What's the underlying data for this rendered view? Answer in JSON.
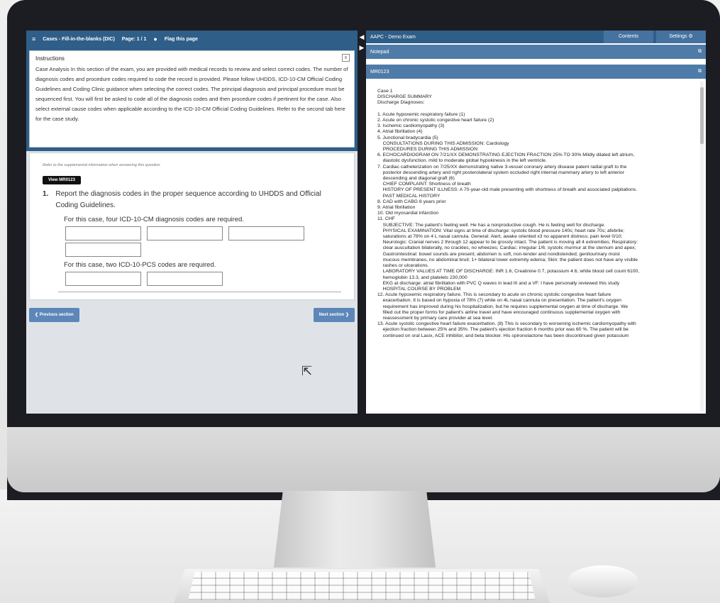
{
  "left": {
    "topbar": {
      "menu_icon": "hamburger-icon",
      "section": "Cases - Fill-in-the-blanks (DIC)",
      "page": "Page: 1 / 1",
      "flag_label": "Flag this page"
    },
    "instructions": {
      "title": "Instructions",
      "close": "x",
      "text": "Case Analysis In this section of the exam, you are provided with medical records to review and select correct codes. The number of diagnosis codes and procedure codes required to code the record is provided. Please follow UHDDS, ICD-10-CM Official Coding Guidelines and Coding Clinic guidance when selecting the correct codes. The principal diagnosis and principal procedure must be sequenced first. You will first be asked to code all of the diagnosis codes and then procedure codes if pertinent for the case. Also select external cause codes when applicable according to the ICD-10-CM Official Coding Guidelines. Refer to the second tab here for the case study."
    },
    "question": {
      "ref_note": "Refer to the supplemental information when answering this question.",
      "view_button": "View MR0123",
      "number": "1.",
      "text": "Report the diagnosis codes in the proper sequence according to UHDDS and Official Coding Guidelines.",
      "dx_req": "For this case, four ICD-10-CM diagnosis codes are required.",
      "pcs_req": "For this case, two ICD-10-PCS codes are required."
    },
    "prev_button": "❮ Previous section",
    "next_button": "Next section ❯"
  },
  "right": {
    "title": "AAPC - Demo Exam",
    "tab_contents": "Contents",
    "tab_settings": "Settings ⚙",
    "notepad": "Notepad",
    "record_tab": "MR0123",
    "expand_icon": "expand-icon",
    "document": "Case 1\nDISCHARGE SUMMARY\nDischarge Diagnoses:\n\n1. Acute hypoxemic respiratory failure (1)\n2. Acute on chronic systolic congestive heart failure (2)\n3. Ischemic cardiomyopathy (3)\n4. Atrial fibrillation (4)\n5. Junctional bradycardia (5)\n    CONSULTATIONS DURING THIS ADMISSION: Cardiology\n    PROCEDURES DURING THIS ADMISSION\n6. ECHOCARDIOGRAM ON 7/21/XX DEMONSTRATING EJECTION FRACTION 25% TO 30% Mildly dilated left atrium,\n    diastolic dysfunction, mild to moderate global hypokinesis in the left ventricle.\n7. Cardiac catheterization on 7/25/XX demonstrating native 3-vessel coronary artery disease patent radial graft to the\n    posterior descending artery and right posterolateral system occluded right internal mammary artery to left anterior\n    descending and diagonal graft (6)\n    CHIEF COMPLAINT: Shortness of breath\n    HISTORY OF PRESENT ILLNESS: A 70-year-old male presenting with shortness of breath and associated palpitations.\n    PAST MEDICAL HISTORY\n8. CAD with CABG 8 years prior\n9. Atrial fibrillation\n10. Old myocardial infarction\n11. CHF\n    SUBJECTIVE: The patient's feeling well. He has a nonproductive cough. He is feeling well for discharge.\n    PHYSICAL EXAMINATION: Vital signs at time of discharge: systolic blood pressure 140s; heart rate 70s; afebrile;\n    saturations at 78% on 4 L nasal cannula. General: Alert, awake oriented x3 no apparent distress; pain level 0/10;\n    Neurologic: Cranial nerves 2 through 12 appear to be grossly intact. The patient is moving all 4 extremities; Respiratory:\n    clear auscultation bilaterally, no crackles, no wheezes; Cardiac: irregular 1/6; systolic murmur at the sternum and apex;\n    Gastrointestinal: bowel sounds are present; abdomen is soft, non-tender and nondistended; genitourinary moist\n    mucous membranes, no abdominal bruit; 1+ bilateral lower extremity edema; Skin: the patient does not have any visible\n    rashes or ulcerations.\n    LABORATORY VALUES AT TIME OF DISCHARGE: INR 1.6, Creatinine 0.7, potassium 4.6, white blood cell count 6100,\n    hemoglobin 13.3, and platelets 230,000\n    EKG at discharge: atrial fibrillation with PVC Q waves in lead III and a VF. I have personally reviewed this study\n    HOSPITAL COURSE BY PROBLEM\n12. Acute hypoxemic respiratory failure. This is secondary to acute on chronic systolic congestive heart failure\n    exacerbation. It is based on hypoxia of 78% (7) while on 4L nasal cannula on presentation. The patient's oxygen\n    requirement has improved during his hospitalization, but he requires supplemental oxygen at time of discharge. We\n    filled out the proper forms for patient's airline travel and have encouraged continuous supplemental oxygen with\n    reassessment by primary care provider at sea level.\n13. Acute systolic congestive heart failure exacerbation. (8) This is secondary to worsening ischemic cardiomyopathy with\n    ejection fraction between 25% and 35%. The patient's ejection fraction 6 months prior was 60 %. The patient will be\n    continued on oral Lasix, ACE inhibitor, and beta blocker. His spironolactone has been discontinued given potassium"
  }
}
